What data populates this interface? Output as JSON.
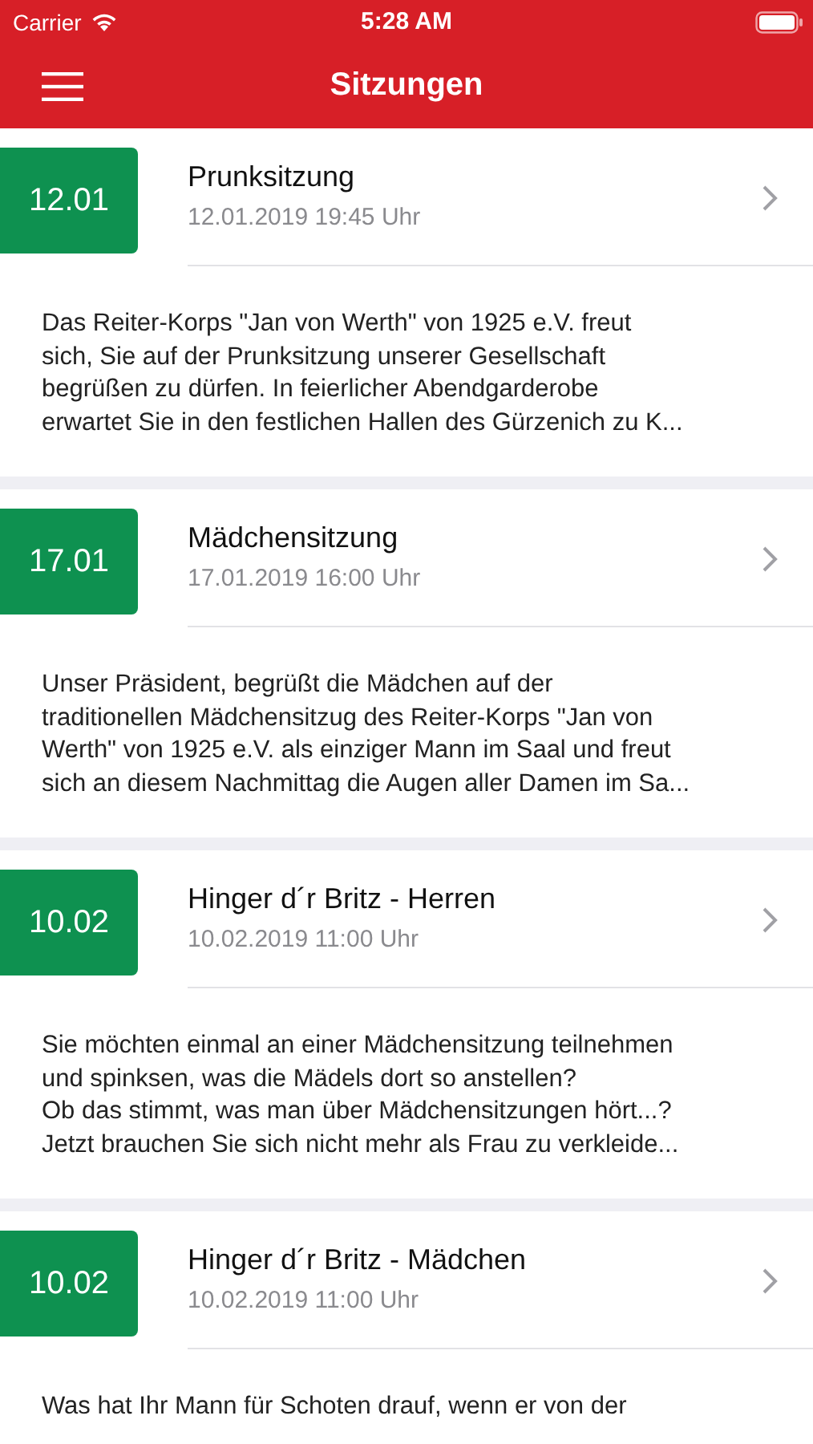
{
  "status_bar": {
    "carrier": "Carrier",
    "time": "5:28 AM"
  },
  "nav_bar": {
    "title": "Sitzungen"
  },
  "sessions": [
    {
      "day": "12.01",
      "title": "Prunksitzung",
      "datetime": "12.01.2019 19:45 Uhr",
      "description": "Das Reiter-Korps \"Jan von Werth\" von 1925 e.V. freut\nsich, Sie auf der Prunksitzung unserer Gesellschaft\nbegrüßen zu dürfen. In feierlicher Abendgarderobe\nerwartet Sie in den festlichen Hallen des Gürzenich zu K..."
    },
    {
      "day": "17.01",
      "title": "Mädchensitzung",
      "datetime": "17.01.2019 16:00 Uhr",
      "description": "Unser Präsident, begrüßt die Mädchen auf der\ntraditionellen Mädchensitzug des Reiter-Korps \"Jan von\nWerth\" von 1925 e.V. als einziger Mann im Saal und freut\nsich an diesem Nachmittag die Augen aller Damen im Sa..."
    },
    {
      "day": "10.02",
      "title": "Hinger d´r Britz  - Herren",
      "datetime": "10.02.2019 11:00 Uhr",
      "description": "Sie möchten einmal an einer Mädchensitzung teilnehmen\nund spinksen, was die Mädels dort so anstellen?\nOb das stimmt, was man über Mädchensitzungen hört...?\nJetzt brauchen Sie sich nicht mehr als Frau zu verkleide..."
    },
    {
      "day": "10.02",
      "title": "Hinger d´r Britz - Mädchen",
      "datetime": "10.02.2019 11:00 Uhr",
      "description": "Was hat Ihr Mann für Schoten drauf, wenn er von der"
    }
  ]
}
